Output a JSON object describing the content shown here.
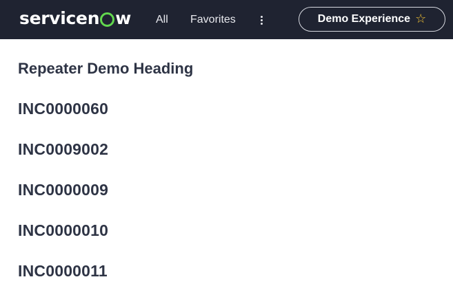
{
  "header": {
    "logo": {
      "pre": "servicen",
      "post": "w"
    },
    "nav": {
      "all": "All",
      "favorites": "Favorites"
    },
    "demo_button": "Demo Experience",
    "star_icon": "star-outline-icon",
    "colors": {
      "bar_bg": "#1f2331",
      "logo_accent": "#62d84e",
      "star": "#f3c233"
    }
  },
  "main": {
    "heading": "Repeater Demo Heading",
    "records": [
      "INC0000060",
      "INC0009002",
      "INC0000009",
      "INC0000010",
      "INC0000011"
    ]
  }
}
